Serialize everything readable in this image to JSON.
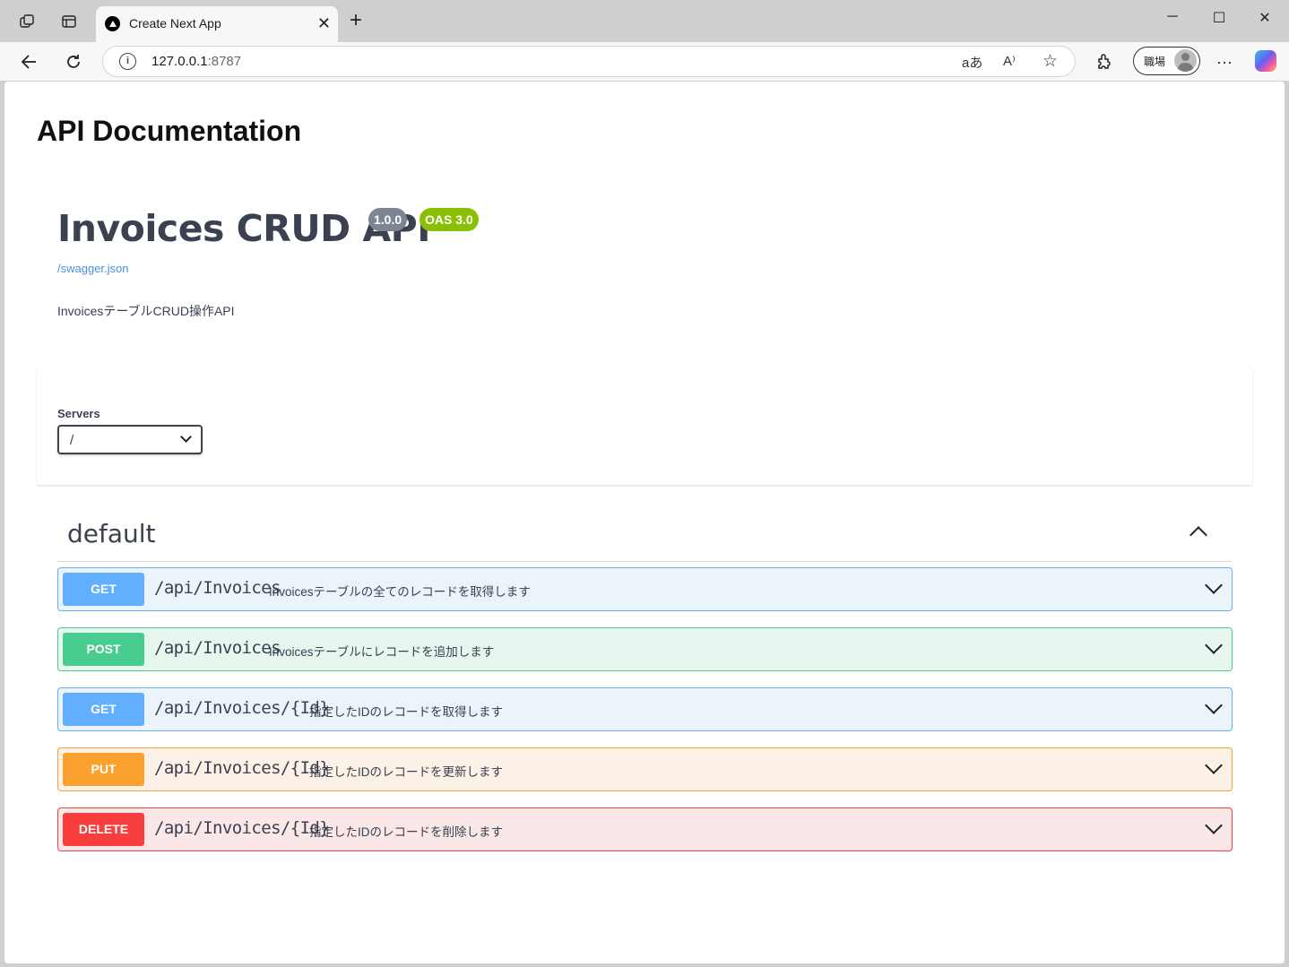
{
  "browser": {
    "tab_title": "Create Next App",
    "url_host": "127.0.0.1",
    "url_port": ":8787",
    "translate_icon_text": "aあ",
    "read_aloud_icon_text": "A⁾",
    "profile_label": "職場"
  },
  "page": {
    "doc_title": "API Documentation",
    "info": {
      "title": "Invoices CRUD API",
      "version": "1.0.0",
      "oas": "OAS 3.0",
      "spec_link": "/swagger.json",
      "description": "InvoicesテーブルCRUD操作API"
    },
    "servers": {
      "label": "Servers",
      "selected": "/"
    },
    "tag": {
      "name": "default"
    },
    "operations": [
      {
        "method": "GET",
        "path": "/api/Invoices",
        "summary": "Invoicesテーブルの全てのレコードを取得します"
      },
      {
        "method": "POST",
        "path": "/api/Invoices",
        "summary": "Invoicesテーブルにレコードを追加します"
      },
      {
        "method": "GET",
        "path": "/api/Invoices/{Id}",
        "summary": "指定したIDのレコードを取得します"
      },
      {
        "method": "PUT",
        "path": "/api/Invoices/{Id}",
        "summary": "指定したIDのレコードを更新します"
      },
      {
        "method": "DELETE",
        "path": "/api/Invoices/{Id}",
        "summary": "指定したIDのレコードを削除します"
      }
    ]
  },
  "colors": {
    "get": "#61affe",
    "post": "#49cc90",
    "put": "#fca130",
    "delete": "#f93e3e",
    "version_badge": "#7d8492",
    "oas_badge": "#89bf04",
    "link": "#4990e2"
  }
}
